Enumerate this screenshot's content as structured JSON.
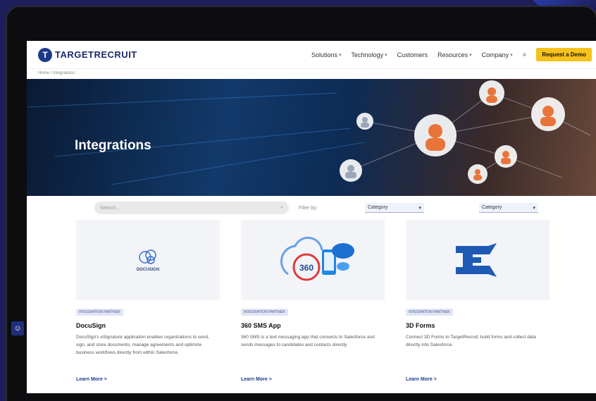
{
  "header": {
    "logo_text": "TARGETRECRUIT",
    "nav": [
      {
        "label": "Solutions"
      },
      {
        "label": "Technology"
      },
      {
        "label": "Customers"
      },
      {
        "label": "Resources"
      },
      {
        "label": "Company"
      }
    ],
    "cta_label": "Request a Demo"
  },
  "breadcrumb": "Home / Integrations",
  "hero": {
    "title": "Integrations"
  },
  "filters": {
    "search_placeholder": "Search...",
    "filter_label": "Filter by:",
    "category_value": "Category",
    "type_value": "Category"
  },
  "cards": [
    {
      "logo_text": "DOCUSIGN",
      "tag": "INTEGRATION PARTNER",
      "title": "DocuSign",
      "desc": "DocuSign's eSignature application enables organizations to send, sign, and store documents, manage agreements and optimize business workflows directly from within Salesforce.",
      "link": "Learn More >"
    },
    {
      "logo_text": "360",
      "tag": "INTEGRATION PARTNER",
      "title": "360 SMS App",
      "desc": "360 SMS is a text messaging app that connects to Salesforce and sends messages to candidates and contacts directly.",
      "link": "Learn More >"
    },
    {
      "logo_text": "",
      "tag": "INTEGRATION PARTNER",
      "title": "3D Forms",
      "desc": "Connect 3D Forms to TargetRecruit; build forms and collect data directly into Salesforce.",
      "link": "Learn More >"
    }
  ],
  "colors": {
    "brand": "#1b3a8a",
    "cta": "#f7c21b",
    "bg": "#1e1e5a"
  }
}
